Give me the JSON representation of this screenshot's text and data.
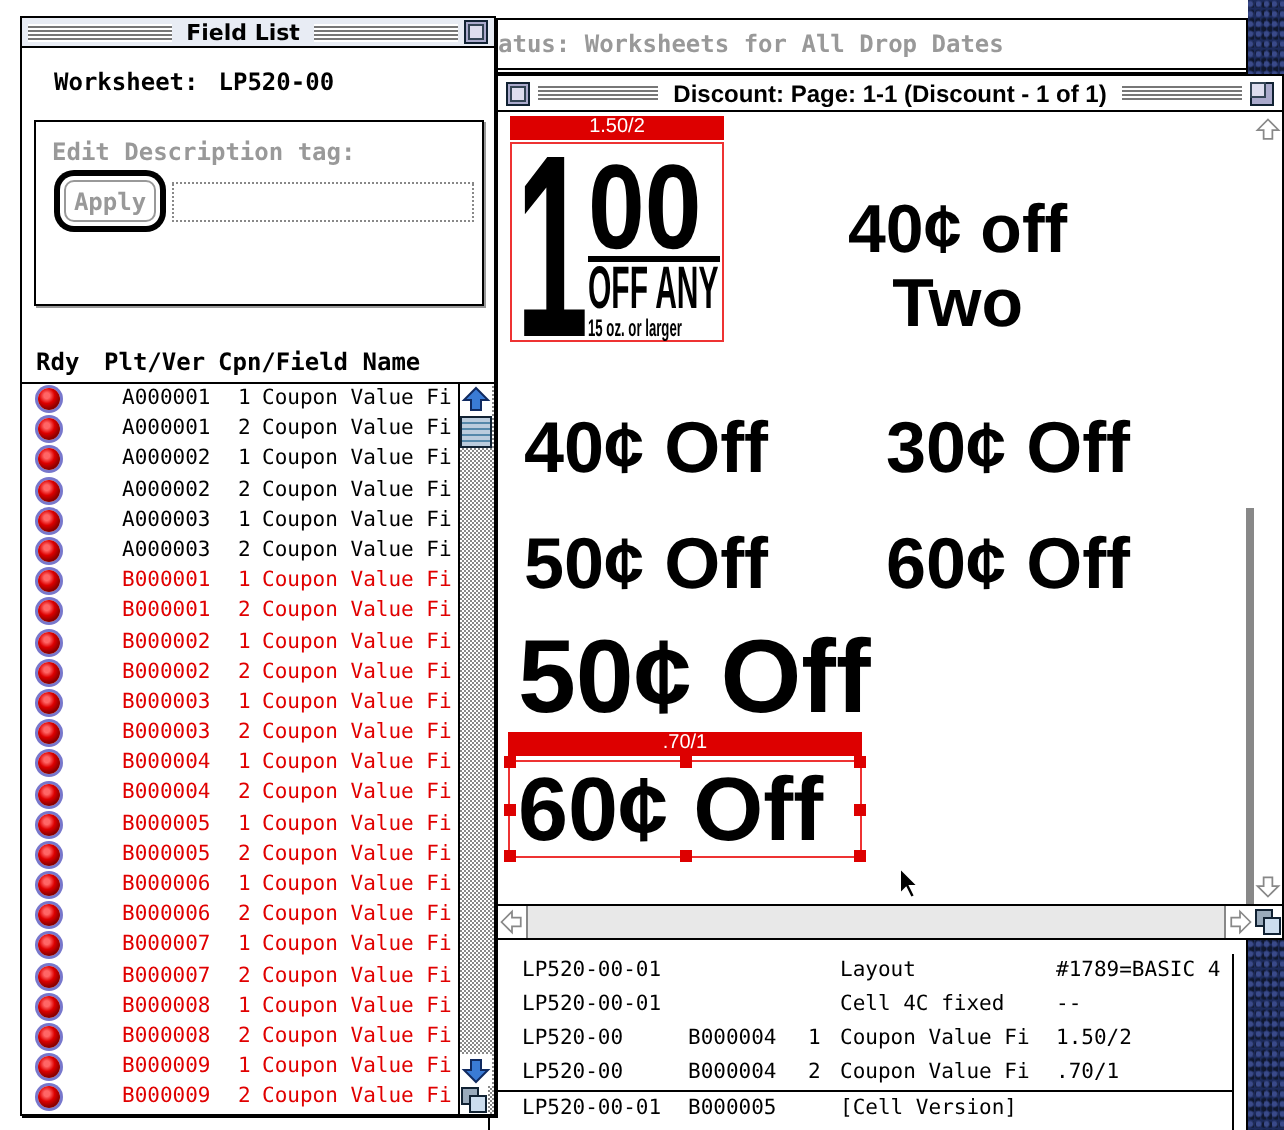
{
  "status_window": {
    "title": "atus: Worksheets for All Drop Dates",
    "rows": [
      {
        "kind": "field",
        "column_1": "LP520-00-01",
        "column_4": "Layout",
        "column_5": "#1789=BASIC 4"
      },
      {
        "kind": "field",
        "column_1": "LP520-00-01",
        "column_4": "Cell 4C fixed",
        "column_5": "--"
      },
      {
        "kind": "field",
        "column_1": "LP520-00",
        "column_2": "B000004",
        "column_3": "1",
        "column_4": "Coupon Value Fi",
        "column_5": "1.50/2"
      },
      {
        "kind": "field",
        "column_1": "LP520-00",
        "column_2": "B000004",
        "column_3": "2",
        "column_4": "Coupon Value Fi",
        "column_5": ".70/1"
      },
      {
        "kind": "version",
        "column_1": "LP520-00-01",
        "column_2": "B000005",
        "column_4": "[Cell Version]"
      }
    ]
  },
  "discount_window": {
    "title": "Discount: Page: 1-1 (Discount - 1 of 1)",
    "items": [
      {
        "kind": "artwork",
        "tag": "1.50/2",
        "selected": false,
        "lines": [
          "1",
          "00",
          "OFF ANY",
          "15 oz. or larger"
        ]
      },
      {
        "kind": "text",
        "selected": false,
        "lines": [
          "40¢ off",
          "Two"
        ]
      },
      {
        "kind": "text",
        "selected": false,
        "lines": [
          "40¢ Off"
        ]
      },
      {
        "kind": "text",
        "selected": false,
        "lines": [
          "30¢ Off"
        ]
      },
      {
        "kind": "text",
        "selected": false,
        "lines": [
          "50¢ Off"
        ]
      },
      {
        "kind": "text",
        "selected": false,
        "lines": [
          "60¢ Off"
        ]
      },
      {
        "kind": "text",
        "selected": false,
        "lines": [
          "50¢ Off"
        ]
      },
      {
        "kind": "text",
        "tag": ".70/1",
        "selected": true,
        "lines": [
          "60¢ Off"
        ]
      }
    ]
  },
  "field_list": {
    "title": "Field List",
    "worksheet_label": "Worksheet:",
    "worksheet": "LP520-00",
    "edit_group": {
      "label": "Edit Description tag:",
      "button": "Apply",
      "disabled": true
    },
    "columns": [
      "Rdy",
      "Plt/Ver",
      "Cpn/Field Name"
    ],
    "rows": [
      {
        "plt": "A000001",
        "cpn": "1",
        "field": "Coupon Value Fi",
        "color": "#000000"
      },
      {
        "plt": "A000001",
        "cpn": "2",
        "field": "Coupon Value Fi",
        "color": "#000000"
      },
      {
        "plt": "A000002",
        "cpn": "1",
        "field": "Coupon Value Fi",
        "color": "#000000"
      },
      {
        "plt": "A000002",
        "cpn": "2",
        "field": "Coupon Value Fi",
        "color": "#000000"
      },
      {
        "plt": "A000003",
        "cpn": "1",
        "field": "Coupon Value Fi",
        "color": "#000000"
      },
      {
        "plt": "A000003",
        "cpn": "2",
        "field": "Coupon Value Fi",
        "color": "#000000"
      },
      {
        "plt": "B000001",
        "cpn": "1",
        "field": "Coupon Value Fi",
        "color": "#e00000"
      },
      {
        "plt": "B000001",
        "cpn": "2",
        "field": "Coupon Value Fi",
        "color": "#e00000"
      },
      {
        "plt": "B000002",
        "cpn": "1",
        "field": "Coupon Value Fi",
        "color": "#e00000"
      },
      {
        "plt": "B000002",
        "cpn": "2",
        "field": "Coupon Value Fi",
        "color": "#e00000"
      },
      {
        "plt": "B000003",
        "cpn": "1",
        "field": "Coupon Value Fi",
        "color": "#e00000"
      },
      {
        "plt": "B000003",
        "cpn": "2",
        "field": "Coupon Value Fi",
        "color": "#e00000"
      },
      {
        "plt": "B000004",
        "cpn": "1",
        "field": "Coupon Value Fi",
        "color": "#e00000"
      },
      {
        "plt": "B000004",
        "cpn": "2",
        "field": "Coupon Value Fi",
        "color": "#e00000"
      },
      {
        "plt": "B000005",
        "cpn": "1",
        "field": "Coupon Value Fi",
        "color": "#e00000"
      },
      {
        "plt": "B000005",
        "cpn": "2",
        "field": "Coupon Value Fi",
        "color": "#e00000"
      },
      {
        "plt": "B000006",
        "cpn": "1",
        "field": "Coupon Value Fi",
        "color": "#e00000"
      },
      {
        "plt": "B000006",
        "cpn": "2",
        "field": "Coupon Value Fi",
        "color": "#e00000"
      },
      {
        "plt": "B000007",
        "cpn": "1",
        "field": "Coupon Value Fi",
        "color": "#e00000"
      },
      {
        "plt": "B000007",
        "cpn": "2",
        "field": "Coupon Value Fi",
        "color": "#e00000"
      },
      {
        "plt": "B000008",
        "cpn": "1",
        "field": "Coupon Value Fi",
        "color": "#e00000"
      },
      {
        "plt": "B000008",
        "cpn": "2",
        "field": "Coupon Value Fi",
        "color": "#e00000"
      },
      {
        "plt": "B000009",
        "cpn": "1",
        "field": "Coupon Value Fi",
        "color": "#e00000"
      },
      {
        "plt": "B000009",
        "cpn": "2",
        "field": "Coupon Value Fi",
        "color": "#e00000"
      }
    ]
  }
}
